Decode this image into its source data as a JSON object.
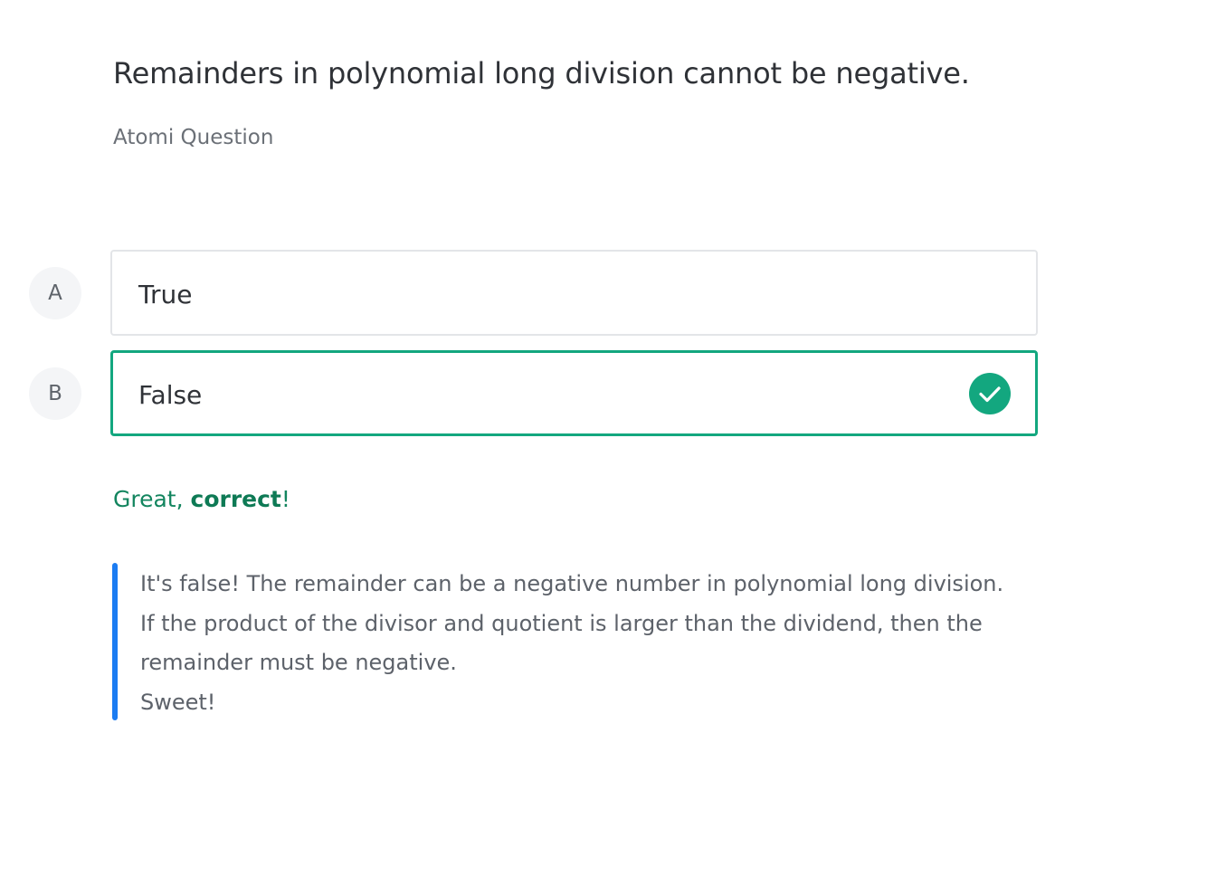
{
  "question": {
    "title": "Remainders in polynomial long division cannot be negative.",
    "source": "Atomi Question"
  },
  "options": [
    {
      "letter": "A",
      "label": "True",
      "selected": false,
      "correct": false
    },
    {
      "letter": "B",
      "label": "False",
      "selected": true,
      "correct": true
    }
  ],
  "feedback": {
    "prefix": "Great, ",
    "emphasis": "correct",
    "suffix": "!"
  },
  "explanation": {
    "lines": [
      "It's false! The remainder can be a negative number in polynomial long division.",
      "If the product of the divisor and quotient is larger than the dividend, then the",
      "remainder must be negative.",
      "Sweet!"
    ]
  },
  "icons": {
    "correct_indicator": "check-circle-icon"
  },
  "colors": {
    "correct": "#13a77f",
    "feedback_text": "#13855f",
    "explanation_accent": "#1b7cf2"
  }
}
